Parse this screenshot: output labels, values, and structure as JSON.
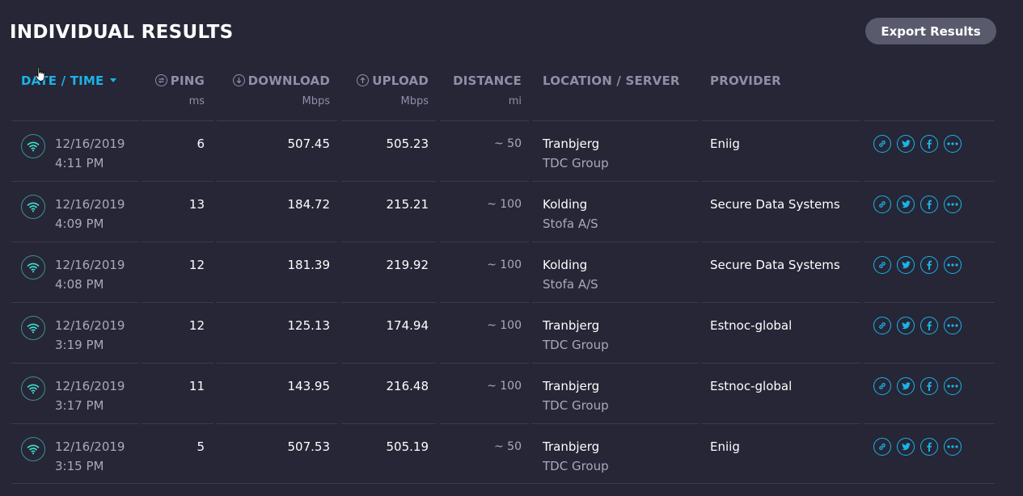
{
  "page": {
    "title": "INDIVIDUAL RESULTS",
    "export_label": "Export Results"
  },
  "columns": {
    "date": "DATE / TIME",
    "ping": "PING",
    "ping_unit": "ms",
    "download": "DOWNLOAD",
    "download_unit": "Mbps",
    "upload": "UPLOAD",
    "upload_unit": "Mbps",
    "distance": "DISTANCE",
    "distance_unit": "mi",
    "location": "LOCATION / SERVER",
    "provider": "PROVIDER"
  },
  "results": [
    {
      "date": "12/16/2019",
      "time": "4:11 PM",
      "ping": "6",
      "download": "507.45",
      "upload": "505.23",
      "distance": "~ 50",
      "location": "Tranbjerg",
      "server": "TDC Group",
      "provider": "Eniig"
    },
    {
      "date": "12/16/2019",
      "time": "4:09 PM",
      "ping": "13",
      "download": "184.72",
      "upload": "215.21",
      "distance": "~ 100",
      "location": "Kolding",
      "server": "Stofa A/S",
      "provider": "Secure Data Systems"
    },
    {
      "date": "12/16/2019",
      "time": "4:08 PM",
      "ping": "12",
      "download": "181.39",
      "upload": "219.92",
      "distance": "~ 100",
      "location": "Kolding",
      "server": "Stofa A/S",
      "provider": "Secure Data Systems"
    },
    {
      "date": "12/16/2019",
      "time": "3:19 PM",
      "ping": "12",
      "download": "125.13",
      "upload": "174.94",
      "distance": "~ 100",
      "location": "Tranbjerg",
      "server": "TDC Group",
      "provider": "Estnoc-global"
    },
    {
      "date": "12/16/2019",
      "time": "3:17 PM",
      "ping": "11",
      "download": "143.95",
      "upload": "216.48",
      "distance": "~ 100",
      "location": "Tranbjerg",
      "server": "TDC Group",
      "provider": "Estnoc-global"
    },
    {
      "date": "12/16/2019",
      "time": "3:15 PM",
      "ping": "5",
      "download": "507.53",
      "upload": "505.19",
      "distance": "~ 50",
      "location": "Tranbjerg",
      "server": "TDC Group",
      "provider": "Eniig"
    }
  ],
  "icons": {
    "connection": "wifi-icon",
    "actions": [
      "link-icon",
      "twitter-icon",
      "facebook-icon",
      "more-icon"
    ],
    "ping": "ping-icon",
    "download": "download-arrow-icon",
    "upload": "upload-arrow-icon",
    "sort": "caret-down-icon"
  },
  "colors": {
    "background": "#262637",
    "accent": "#1ab3e6",
    "header_text": "#8e90a8",
    "connection_icon": "#3f8f8c",
    "export_button": "#5a5a6d"
  }
}
